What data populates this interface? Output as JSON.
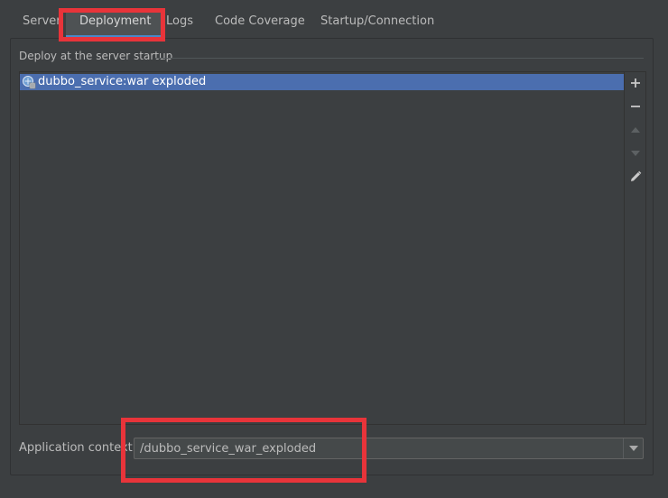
{
  "tabs": [
    {
      "label": "Server",
      "selected": false
    },
    {
      "label": "Deployment",
      "selected": true
    },
    {
      "label": "Logs",
      "selected": false
    },
    {
      "label": "Code Coverage",
      "selected": false
    },
    {
      "label": "Startup/Connection",
      "selected": false
    }
  ],
  "deploy": {
    "group_title": "Deploy at the server startup",
    "items": [
      {
        "label": "dubbo_service:war exploded",
        "icon": "artifact-icon",
        "selected": true
      }
    ],
    "toolbar": [
      {
        "name": "add-icon",
        "enabled": true
      },
      {
        "name": "remove-icon",
        "enabled": true
      },
      {
        "name": "move-up-icon",
        "enabled": false
      },
      {
        "name": "move-down-icon",
        "enabled": false
      },
      {
        "name": "edit-icon",
        "enabled": true
      }
    ]
  },
  "context": {
    "label": "Application context:",
    "value": "/dubbo_service_war_exploded"
  },
  "colors": {
    "selection": "#4b6eaf",
    "annotation": "#e8343a",
    "background": "#3c3f41"
  }
}
